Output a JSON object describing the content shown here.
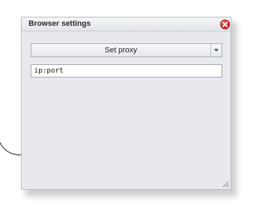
{
  "dialog": {
    "title": "Browser settings",
    "close_icon": "close-icon",
    "proxy_select": {
      "selected": "Set proxy",
      "arrow_icon": "chevron-down-icon"
    },
    "proxy_input": {
      "value": "ip:port"
    },
    "resize_icon": "resize-grip-icon"
  },
  "colors": {
    "panel_bg": "#e7e9ed",
    "close_red": "#d42b2b",
    "border": "#b6bac1"
  }
}
